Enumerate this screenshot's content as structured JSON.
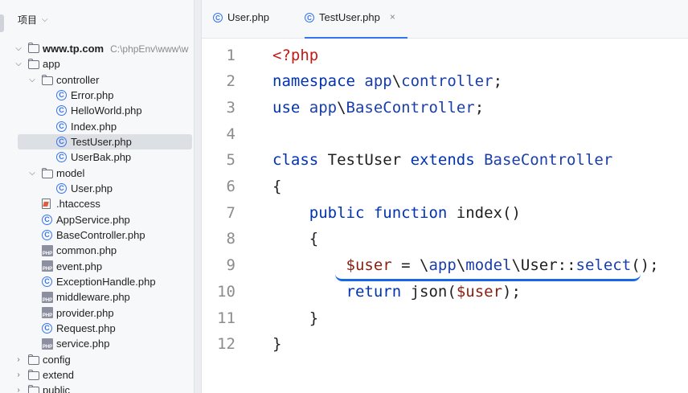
{
  "sidebar": {
    "title": "项目",
    "root": {
      "name": "www.tp.com",
      "path": "C:\\phpEnv\\www\\w"
    },
    "tree": [
      {
        "label": "app",
        "type": "folder",
        "depth": 1,
        "expanded": true
      },
      {
        "label": "controller",
        "type": "folder",
        "depth": 2,
        "expanded": true
      },
      {
        "label": "Error.php",
        "type": "class",
        "depth": 3
      },
      {
        "label": "HelloWorld.php",
        "type": "class",
        "depth": 3
      },
      {
        "label": "Index.php",
        "type": "class",
        "depth": 3
      },
      {
        "label": "TestUser.php",
        "type": "class",
        "depth": 3,
        "selected": true
      },
      {
        "label": "UserBak.php",
        "type": "class",
        "depth": 3
      },
      {
        "label": "model",
        "type": "folder",
        "depth": 2,
        "expanded": true
      },
      {
        "label": "User.php",
        "type": "class",
        "depth": 3
      },
      {
        "label": ".htaccess",
        "type": "file",
        "depth": 2
      },
      {
        "label": "AppService.php",
        "type": "class",
        "depth": 2
      },
      {
        "label": "BaseController.php",
        "type": "class",
        "depth": 2
      },
      {
        "label": "common.php",
        "type": "php",
        "depth": 2
      },
      {
        "label": "event.php",
        "type": "php",
        "depth": 2
      },
      {
        "label": "ExceptionHandle.php",
        "type": "class",
        "depth": 2
      },
      {
        "label": "middleware.php",
        "type": "php",
        "depth": 2
      },
      {
        "label": "provider.php",
        "type": "php",
        "depth": 2
      },
      {
        "label": "Request.php",
        "type": "class",
        "depth": 2
      },
      {
        "label": "service.php",
        "type": "php",
        "depth": 2
      },
      {
        "label": "config",
        "type": "folder",
        "depth": 1,
        "expanded": false
      },
      {
        "label": "extend",
        "type": "folder",
        "depth": 1,
        "expanded": false
      },
      {
        "label": "public",
        "type": "folder",
        "depth": 1,
        "expanded": false
      }
    ]
  },
  "tabs": [
    {
      "label": "User.php",
      "active": false
    },
    {
      "label": "TestUser.php",
      "active": true,
      "close": "×"
    }
  ],
  "code": [
    {
      "n": "1",
      "tokens": [
        [
          "tag",
          "<?php"
        ]
      ]
    },
    {
      "n": "2",
      "tokens": [
        [
          "kw",
          "namespace "
        ],
        [
          "ns",
          "app"
        ],
        [
          "plain",
          "\\"
        ],
        [
          "ns",
          "controller"
        ],
        [
          "plain",
          ";"
        ]
      ]
    },
    {
      "n": "3",
      "tokens": [
        [
          "kw",
          "use "
        ],
        [
          "ns",
          "app"
        ],
        [
          "plain",
          "\\"
        ],
        [
          "ns",
          "BaseController"
        ],
        [
          "plain",
          ";"
        ]
      ]
    },
    {
      "n": "4",
      "tokens": []
    },
    {
      "n": "5",
      "tokens": [
        [
          "kw",
          "class "
        ],
        [
          "plain",
          "TestUser "
        ],
        [
          "kw",
          "extends "
        ],
        [
          "ns",
          "BaseController"
        ]
      ]
    },
    {
      "n": "6",
      "tokens": [
        [
          "plain",
          "{"
        ]
      ]
    },
    {
      "n": "7",
      "tokens": [
        [
          "plain",
          "    "
        ],
        [
          "kw",
          "public function "
        ],
        [
          "fn",
          "index"
        ],
        [
          "plain",
          "()"
        ]
      ]
    },
    {
      "n": "8",
      "tokens": [
        [
          "plain",
          "    {"
        ]
      ]
    },
    {
      "n": "9",
      "tokens": [
        [
          "plain",
          "        "
        ],
        [
          "var",
          "$user"
        ],
        [
          "plain",
          " = \\"
        ],
        [
          "ns",
          "app"
        ],
        [
          "plain",
          "\\"
        ],
        [
          "ns",
          "model"
        ],
        [
          "plain",
          "\\User::"
        ],
        [
          "ns",
          "select"
        ],
        [
          "plain",
          "();"
        ]
      ]
    },
    {
      "n": "10",
      "tokens": [
        [
          "plain",
          "        "
        ],
        [
          "kw",
          "return "
        ],
        [
          "fn",
          "json"
        ],
        [
          "plain",
          "("
        ],
        [
          "var",
          "$user"
        ],
        [
          "plain",
          ");"
        ]
      ]
    },
    {
      "n": "11",
      "tokens": [
        [
          "plain",
          "    }"
        ]
      ]
    },
    {
      "n": "12",
      "tokens": [
        [
          "plain",
          "}"
        ]
      ]
    }
  ],
  "colors": {
    "accent": "#3574f0",
    "keyword": "#0033b3",
    "annotation_underline": "#1768e5"
  }
}
